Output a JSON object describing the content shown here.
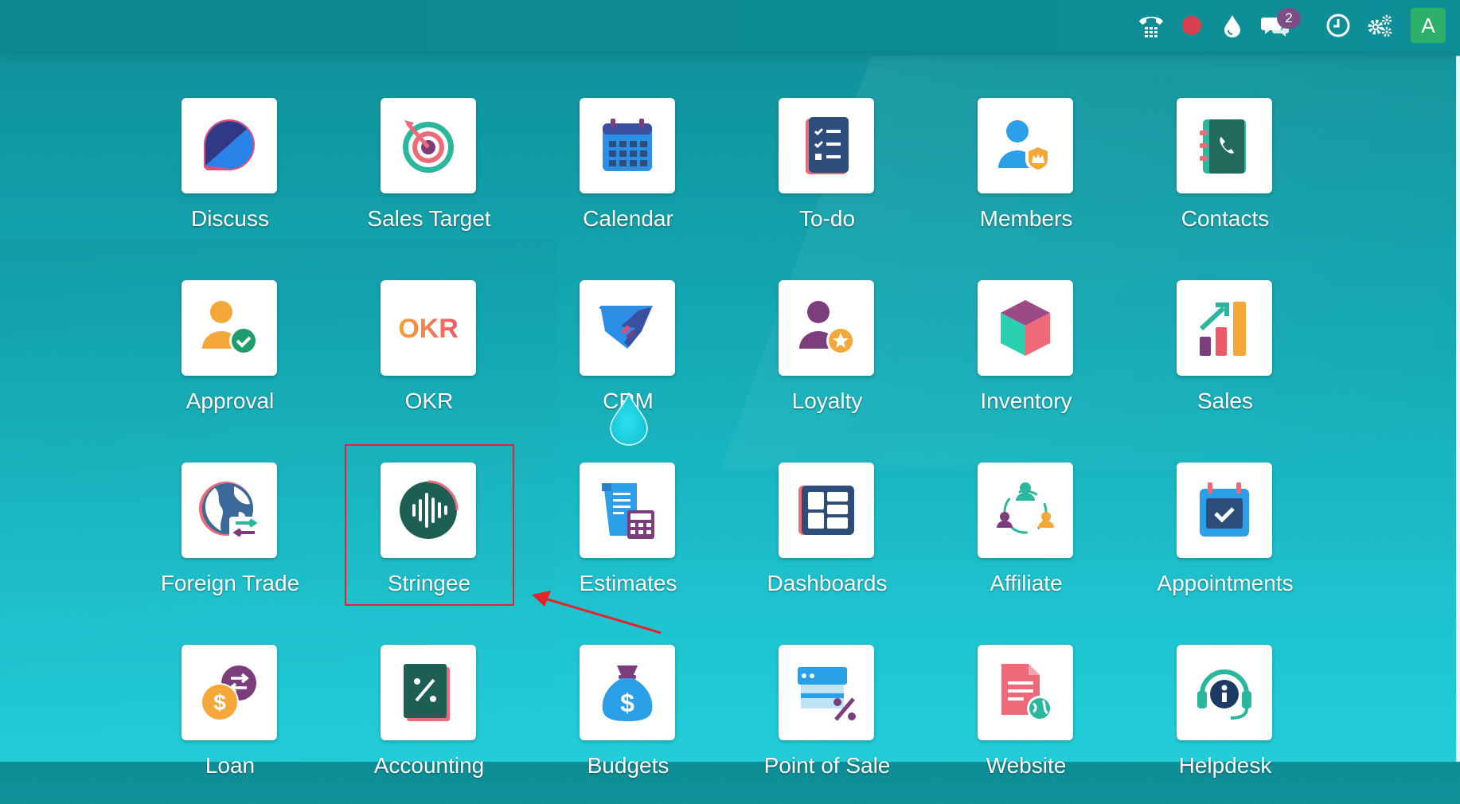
{
  "navbar": {
    "icons": [
      "phone-icon",
      "record-icon",
      "drop-icon",
      "chat-icon",
      "clock-icon",
      "gears-icon"
    ],
    "chat_badge": "2",
    "avatar_letter": "A",
    "avatar_color": "#2db06a"
  },
  "apps": [
    {
      "label": "Discuss",
      "icon": "discuss-icon"
    },
    {
      "label": "Sales Target",
      "icon": "target-icon"
    },
    {
      "label": "Calendar",
      "icon": "calendar-icon"
    },
    {
      "label": "To-do",
      "icon": "checklist-icon"
    },
    {
      "label": "Members",
      "icon": "member-badge-icon"
    },
    {
      "label": "Contacts",
      "icon": "contact-book-icon"
    },
    {
      "label": "Approval",
      "icon": "approval-user-icon"
    },
    {
      "label": "OKR",
      "icon": "okr-logo-icon",
      "logo_text": "OKR"
    },
    {
      "label": "CRM",
      "icon": "handshake-icon"
    },
    {
      "label": "Loyalty",
      "icon": "loyalty-user-icon"
    },
    {
      "label": "Inventory",
      "icon": "cube-icon"
    },
    {
      "label": "Sales",
      "icon": "bar-chart-icon"
    },
    {
      "label": "Foreign Trade",
      "icon": "globe-exchange-icon"
    },
    {
      "label": "Stringee",
      "icon": "soundwave-icon"
    },
    {
      "label": "Estimates",
      "icon": "estimate-calculator-icon"
    },
    {
      "label": "Dashboards",
      "icon": "dashboard-layout-icon"
    },
    {
      "label": "Affiliate",
      "icon": "affiliate-network-icon"
    },
    {
      "label": "Appointments",
      "icon": "calendar-check-icon"
    },
    {
      "label": "Loan",
      "icon": "loan-coins-icon"
    },
    {
      "label": "Accounting",
      "icon": "percent-book-icon"
    },
    {
      "label": "Budgets",
      "icon": "money-bag-icon"
    },
    {
      "label": "Point of Sale",
      "icon": "pos-shop-icon"
    },
    {
      "label": "Website",
      "icon": "web-document-icon"
    },
    {
      "label": "Helpdesk",
      "icon": "headset-icon"
    }
  ],
  "annotation": {
    "highlight_color": "#e5242a",
    "target": "Stringee"
  }
}
